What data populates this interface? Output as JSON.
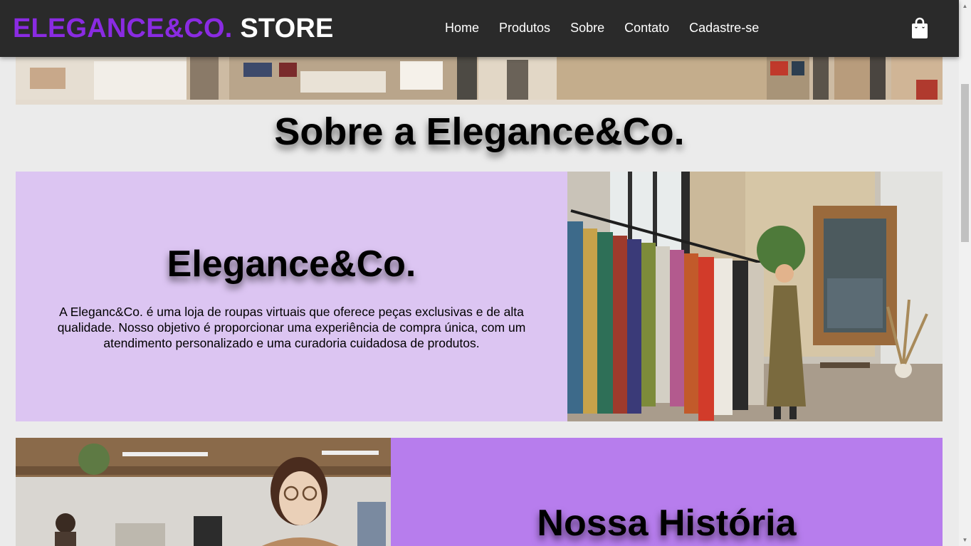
{
  "header": {
    "brand_part1": "ELEGANCE&CO.",
    "brand_part2": "STORE",
    "nav": [
      {
        "label": "Home"
      },
      {
        "label": "Produtos"
      },
      {
        "label": "Sobre"
      },
      {
        "label": "Contato"
      },
      {
        "label": "Cadastre-se"
      }
    ],
    "cart_icon": "shopping-bag-icon"
  },
  "page": {
    "title": "Sobre a Elegance&Co."
  },
  "about": {
    "heading": "Elegance&Co.",
    "body": "A Eleganc&Co. é uma loja de roupas virtuais que oferece peças exclusivas e de alta qualidade. Nosso objetivo é proporcionar uma experiência de compra única, com um atendimento personalizado e uma curadoria cuidadosa de produtos."
  },
  "history": {
    "heading": "Nossa História"
  },
  "colors": {
    "brand_purple": "#8a2be2",
    "header_bg": "#2a2a2a",
    "about_bg": "#dcc5f2",
    "history_bg": "#b77ded",
    "page_bg": "#ebebeb"
  }
}
